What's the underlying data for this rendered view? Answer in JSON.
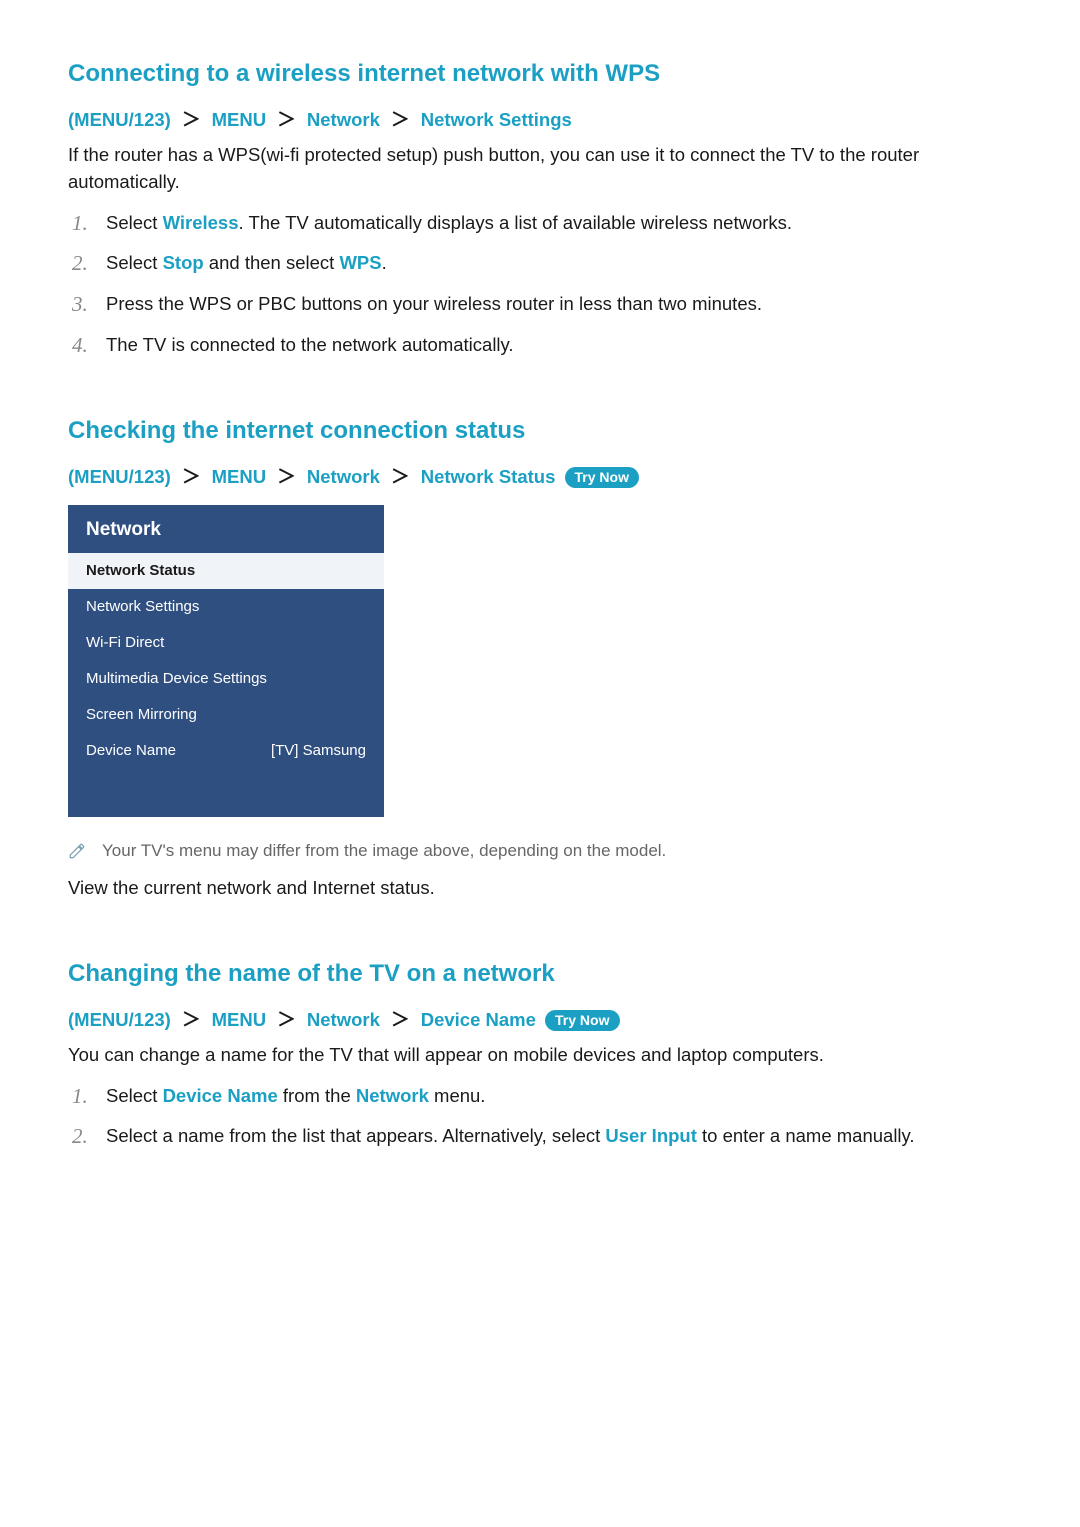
{
  "colors": {
    "accent": "#1ba0c4",
    "menu_bg": "#2f4f80"
  },
  "sec1": {
    "heading": "Connecting to a wireless internet network with WPS",
    "crumbs": {
      "p0a": "(",
      "p0b": "MENU/123",
      "p0c": ") ",
      "p1": "MENU",
      "p2": "Network",
      "p3": "Network Settings"
    },
    "intro": "If the router has a WPS(wi-fi protected setup) push button, you can use it to connect the TV to the router automatically.",
    "steps": [
      {
        "n": "1.",
        "pre": "Select ",
        "em1": "Wireless",
        "post": ". The TV automatically displays a list of available wireless networks."
      },
      {
        "n": "2.",
        "pre": "Select ",
        "em1": "Stop",
        "mid": " and then select ",
        "em2": "WPS",
        "post": "."
      },
      {
        "n": "3.",
        "pre": "Press the WPS or PBC buttons on your wireless router in less than two minutes."
      },
      {
        "n": "4.",
        "pre": "The TV is connected to the network automatically."
      }
    ]
  },
  "sec2": {
    "heading": "Checking the internet connection status",
    "crumbs": {
      "p0a": "(",
      "p0b": "MENU/123",
      "p0c": ") ",
      "p1": "MENU",
      "p2": "Network",
      "p3": "Network Status"
    },
    "trynow": "Try Now",
    "menu": {
      "title": "Network",
      "items": [
        {
          "label": "Network Status",
          "selected": true
        },
        {
          "label": "Network Settings"
        },
        {
          "label": "Wi-Fi Direct"
        },
        {
          "label": "Multimedia Device Settings"
        },
        {
          "label": "Screen Mirroring"
        },
        {
          "label": "Device Name",
          "value": "[TV] Samsung"
        }
      ]
    },
    "note": "Your TV's menu may differ from the image above, depending on the model.",
    "body": "View the current network and Internet status."
  },
  "sec3": {
    "heading": "Changing the name of the TV on a network",
    "crumbs": {
      "p0a": "(",
      "p0b": "MENU/123",
      "p0c": ") ",
      "p1": "MENU",
      "p2": "Network",
      "p3": "Device Name"
    },
    "trynow": "Try Now",
    "intro": "You can change a name for the TV that will appear on mobile devices and laptop computers.",
    "steps": [
      {
        "n": "1.",
        "pre": "Select ",
        "em1": "Device Name",
        "mid": " from the ",
        "em2": "Network",
        "post": " menu."
      },
      {
        "n": "2.",
        "pre": "Select a name from the list that appears. Alternatively, select ",
        "em1": "User Input",
        "post": " to enter a name manually."
      }
    ]
  },
  "sep": "＞"
}
